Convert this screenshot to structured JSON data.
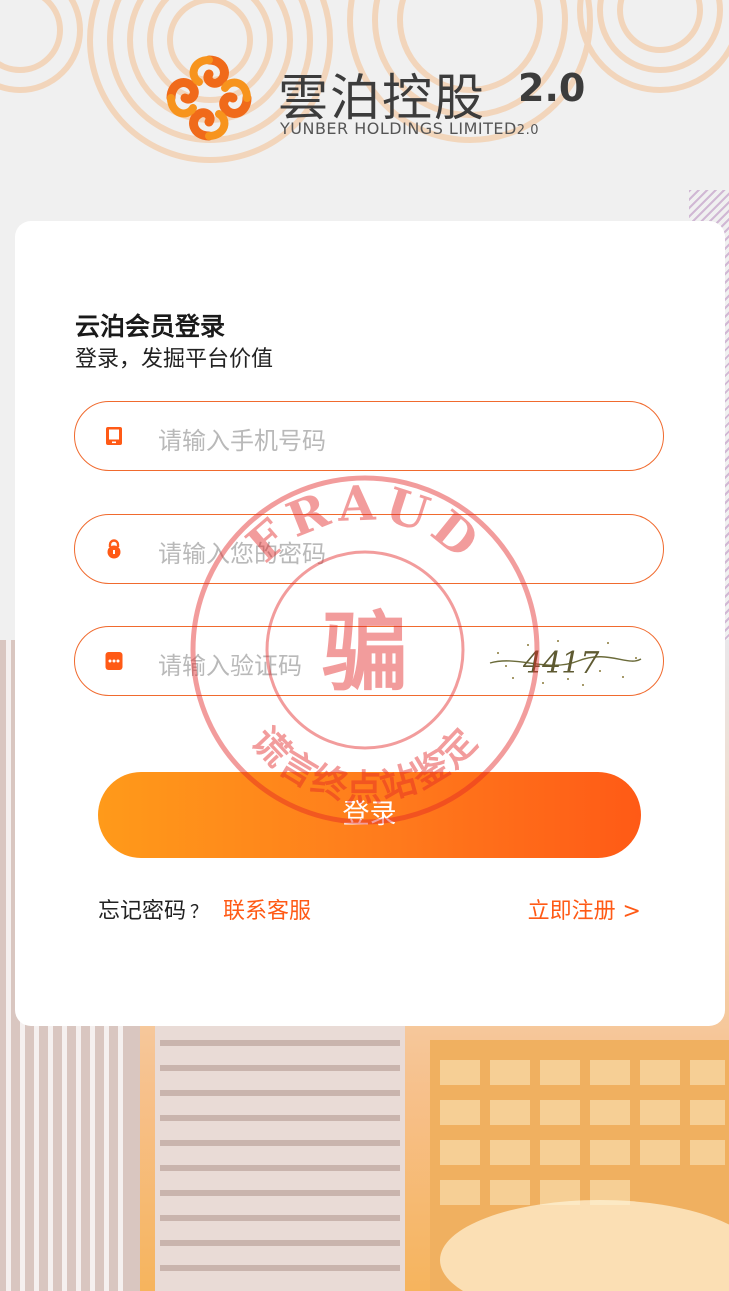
{
  "brand": {
    "name_cn": "雲泊控股",
    "version": "2.0",
    "name_en": "YUNBER HOLDINGS LIMITED",
    "name_en_version": "2.0",
    "accent_color": "#ff6a1a"
  },
  "login": {
    "title": "云泊会员登录",
    "subtitle": "登录，发掘平台价值",
    "phone_placeholder": "请输入手机号码",
    "password_placeholder": "请输入您的密码",
    "code_placeholder": "请输入验证码",
    "captcha_text": "4417",
    "submit_label": "登录",
    "forgot_label": "忘记密码",
    "forgot_q": "？",
    "contact_label": "联系客服",
    "register_label": "立即注册 >"
  },
  "stamp": {
    "top_text": "FRAUD",
    "center_char": "骗",
    "bottom_text": "谎言终点站鉴定"
  },
  "icons": {
    "phone": "phone-icon",
    "lock": "lock-icon",
    "code": "message-code-icon"
  }
}
